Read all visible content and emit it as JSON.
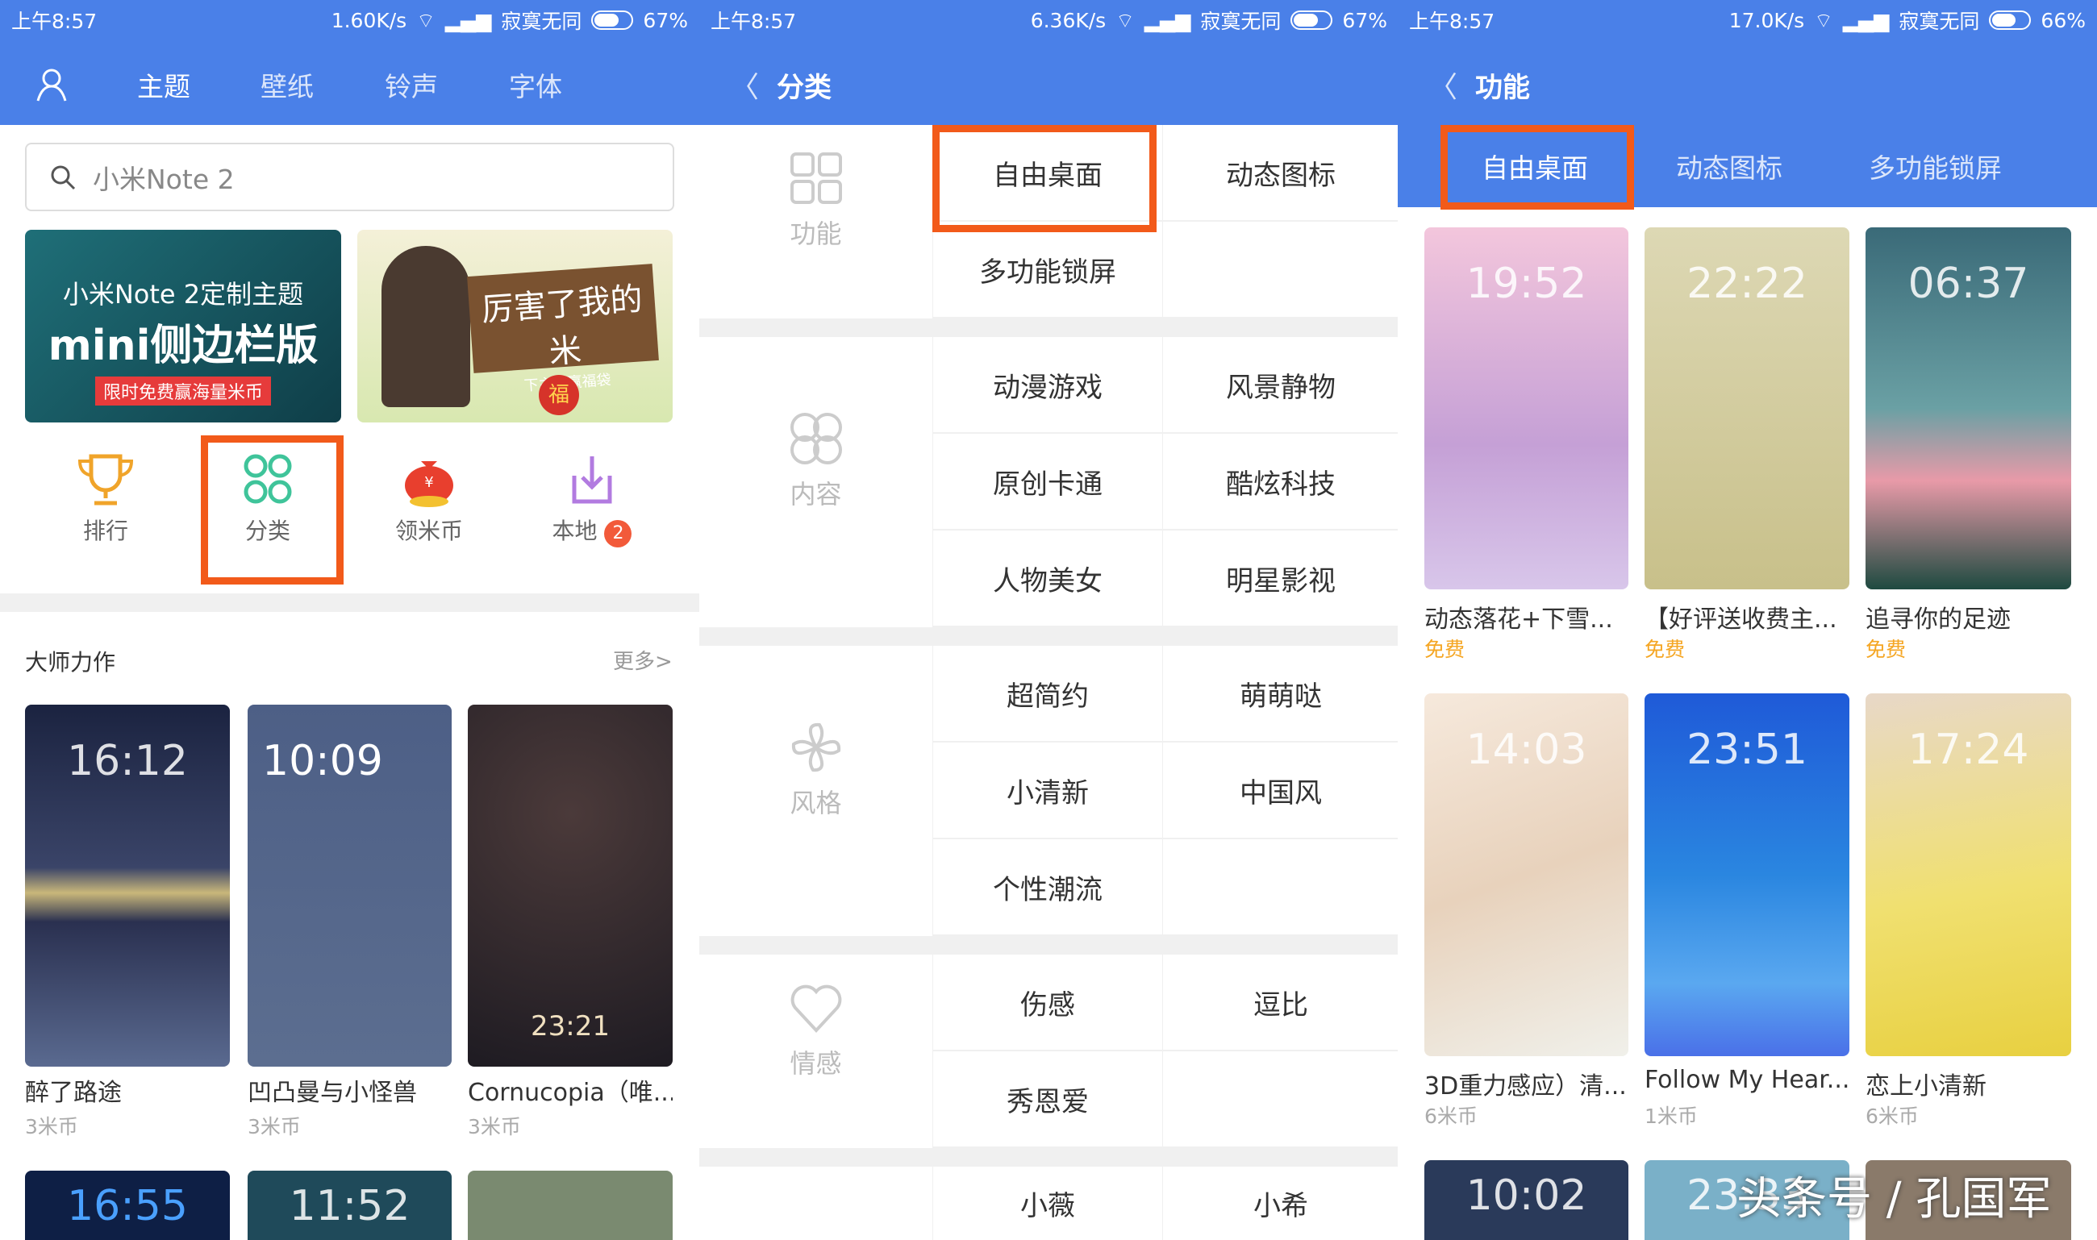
{
  "status_bars": [
    {
      "time": "上午8:57",
      "speed": "1.60K/s",
      "carrier": "寂寞无同",
      "battery": "67%",
      "battery_level": 0.67
    },
    {
      "time": "上午8:57",
      "speed": "6.36K/s",
      "carrier": "寂寞无同",
      "battery": "67%",
      "battery_level": 0.67
    },
    {
      "time": "上午8:57",
      "speed": "17.0K/s",
      "carrier": "寂寞无同",
      "battery": "66%",
      "battery_level": 0.66
    }
  ],
  "colors": {
    "accent": "#4a80e8",
    "highlight": "#f25a1a",
    "free": "#f5a623"
  },
  "home": {
    "tabs": [
      "主题",
      "壁纸",
      "铃声",
      "字体"
    ],
    "search_placeholder": "小米Note 2",
    "banner1": {
      "title": "小米Note 2定制主题",
      "big": "mini侧边栏版",
      "tag": "限时免费赢海量米币"
    },
    "banner2": {
      "title": "厉害了我的米",
      "sub": "下主题赢福袋",
      "tag": "福"
    },
    "shortcuts": [
      {
        "label": "排行",
        "icon": "trophy-icon"
      },
      {
        "label": "分类",
        "icon": "grid-icon"
      },
      {
        "label": "领米币",
        "icon": "money-bag-icon"
      },
      {
        "label": "本地",
        "icon": "download-icon",
        "badge": "2"
      }
    ],
    "section_title": "大师力作",
    "more": "更多>",
    "cards": [
      {
        "name": "醉了路途",
        "price": "3米币",
        "clock": "16:12"
      },
      {
        "name": "凹凸曼与小怪兽",
        "price": "3米币",
        "clock": "10:09"
      },
      {
        "name": "Cornucopia（唯...",
        "price": "3米币",
        "clock": "23:21"
      }
    ],
    "next_clocks": [
      "16:55",
      "11:52",
      ""
    ]
  },
  "category": {
    "title": "分类",
    "groups": [
      {
        "label": "功能",
        "icon": "grid-icon",
        "items": [
          "自由桌面",
          "动态图标",
          "多功能锁屏",
          ""
        ]
      },
      {
        "label": "内容",
        "icon": "clover-icon",
        "items": [
          "动漫游戏",
          "风景静物",
          "原创卡通",
          "酷炫科技",
          "人物美女",
          "明星影视"
        ]
      },
      {
        "label": "风格",
        "icon": "pinwheel-icon",
        "items": [
          "超简约",
          "萌萌哒",
          "小清新",
          "中国风",
          "个性潮流",
          ""
        ]
      },
      {
        "label": "情感",
        "icon": "heart-icon",
        "items": [
          "伤感",
          "逗比",
          "秀恩爱",
          ""
        ]
      },
      {
        "label": "",
        "icon": "",
        "items": [
          "小薇",
          "小希"
        ]
      }
    ]
  },
  "feature": {
    "title": "功能",
    "tabs": [
      "自由桌面",
      "动态图标",
      "多功能锁屏"
    ],
    "cards": [
      {
        "name": "动态落花+下雪...",
        "price": "免费",
        "clock": "19:52"
      },
      {
        "name": "【好评送收费主...",
        "price": "免费",
        "clock": "22:22"
      },
      {
        "name": "追寻你的足迹",
        "price": "免费",
        "clock": "06:37"
      },
      {
        "name": "3D重力感应）清...",
        "price": "6米币",
        "clock": "14:03"
      },
      {
        "name": "Follow My Hear...",
        "price": "1米币",
        "clock": "23:51"
      },
      {
        "name": "恋上小清新",
        "price": "6米币",
        "clock": "17:24"
      }
    ],
    "next_clocks": [
      "10:02",
      "23:33",
      ""
    ]
  },
  "watermark": "头条号 / 孔国军"
}
